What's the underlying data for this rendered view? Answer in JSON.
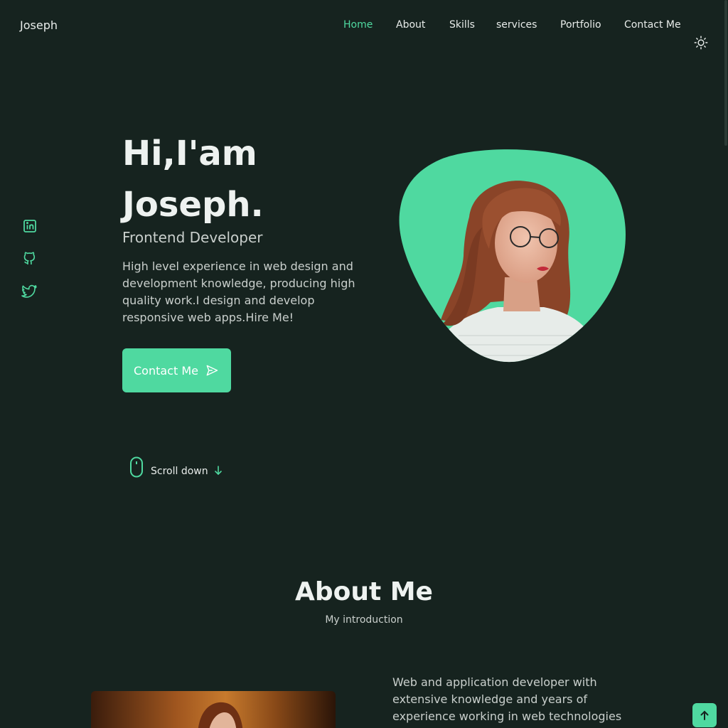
{
  "header": {
    "logo": "Joseph",
    "nav": [
      {
        "label": "Home",
        "active": true
      },
      {
        "label": "About",
        "active": false
      },
      {
        "label": "Skills",
        "active": false
      },
      {
        "label": "services",
        "active": false
      },
      {
        "label": "Portfolio",
        "active": false
      },
      {
        "label": "Contact Me",
        "active": false
      }
    ],
    "theme_icon": "sun-icon"
  },
  "social": [
    {
      "icon": "linkedin-icon"
    },
    {
      "icon": "github-icon"
    },
    {
      "icon": "twitter-icon"
    }
  ],
  "hero": {
    "title_line1": "Hi,I'am",
    "title_line2": "Joseph.",
    "subtitle": "Frontend Developer",
    "description": "High level experience in web design and development knowledge, producing high quality work.I design and develop responsive web apps.Hire Me!",
    "cta_label": "Contact Me",
    "cta_icon": "send-icon",
    "scroll_label": "Scroll down"
  },
  "about": {
    "title": "About Me",
    "subtitle": "My introduction",
    "text": "Web and application developer with extensive knowledge and years of experience working in web technologies and"
  },
  "colors": {
    "background": "#16231f",
    "accent": "#4fd9a0",
    "text": "#e8ecea",
    "muted": "#c9cfcc"
  }
}
